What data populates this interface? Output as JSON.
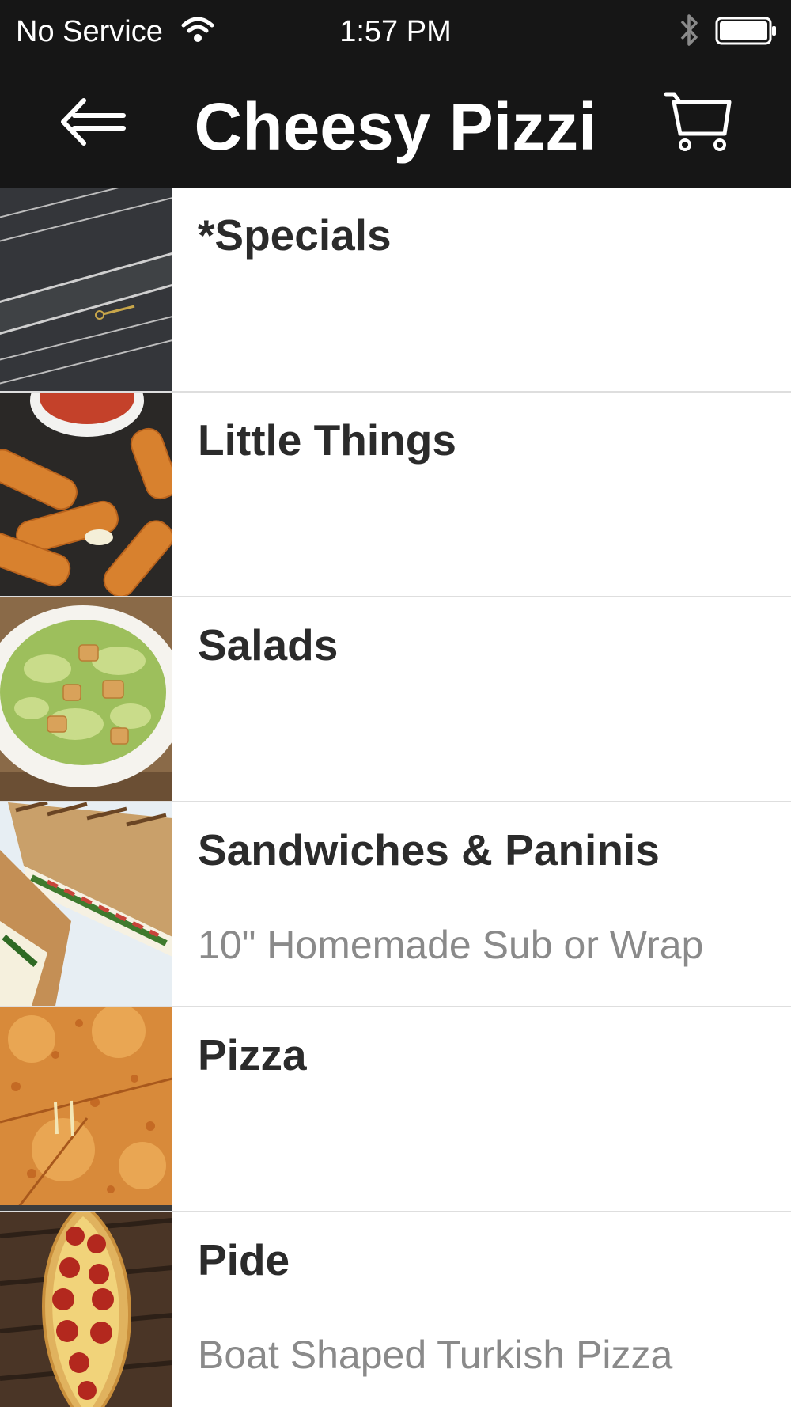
{
  "status_bar": {
    "carrier": "No Service",
    "time": "1:57 PM",
    "wifi_icon": "wifi-icon",
    "bluetooth_icon": "bluetooth-icon",
    "battery_icon": "battery-full-icon"
  },
  "nav": {
    "title": "Cheesy Pizzi",
    "back_icon": "arrow-left-icon",
    "cart_icon": "cart-icon"
  },
  "colors": {
    "header_background": "#161616",
    "header_text": "#ffffff",
    "title_text": "#2b2b2b",
    "subtitle_text": "#8a8a8a",
    "divider": "#dedede"
  },
  "categories": [
    {
      "title": "*Specials",
      "subtitle": "",
      "image": "chalkboard-specials-photo"
    },
    {
      "title": "Little Things",
      "subtitle": "",
      "image": "mozzarella-sticks-photo"
    },
    {
      "title": "Salads",
      "subtitle": "",
      "image": "caesar-salad-photo"
    },
    {
      "title": "Sandwiches & Paninis",
      "subtitle": "10\" Homemade Sub or Wrap",
      "image": "panini-photo"
    },
    {
      "title": "Pizza",
      "subtitle": "",
      "image": "cheese-pizza-photo"
    },
    {
      "title": "Pide",
      "subtitle": "Boat Shaped Turkish Pizza",
      "image": "pide-photo"
    }
  ]
}
